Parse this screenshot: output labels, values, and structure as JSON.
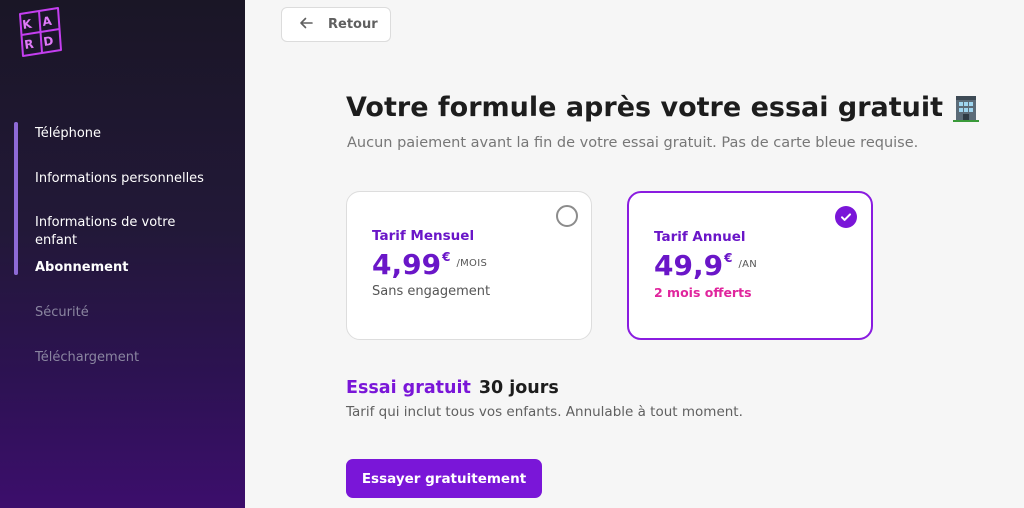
{
  "brand": {
    "logo_text": "KARD"
  },
  "sidebar": {
    "items": [
      {
        "label": "Téléphone"
      },
      {
        "label": "Informations personnelles"
      },
      {
        "label": "Informations de votre enfant"
      },
      {
        "label": "Abonnement"
      },
      {
        "label": "Sécurité"
      },
      {
        "label": "Téléchargement"
      }
    ],
    "progress_steps_completed": 4
  },
  "header": {
    "back_label": "Retour"
  },
  "main": {
    "title": "Votre formule après votre essai gratuit",
    "title_icon": "office-building-emoji",
    "subtitle": "Aucun paiement avant la fin de votre essai gratuit. Pas de carte bleue requise.",
    "plans": [
      {
        "name": "Tarif Mensuel",
        "price": "4,99",
        "currency": "€",
        "period": "/MOIS",
        "note": "Sans engagement",
        "selected": false
      },
      {
        "name": "Tarif Annuel",
        "price": "49,9",
        "currency": "€",
        "period": "/AN",
        "note": "2 mois offerts",
        "selected": true
      }
    ],
    "trial": {
      "label": "Essai gratuit",
      "duration": "30 jours",
      "description": "Tarif qui inclut tous vos enfants. Annulable à tout moment."
    },
    "cta_label": "Essayer gratuitement"
  },
  "colors": {
    "accent": "#7a16d8",
    "offer": "#e0259d",
    "sidebar_bottom": "#3c0e6c"
  }
}
